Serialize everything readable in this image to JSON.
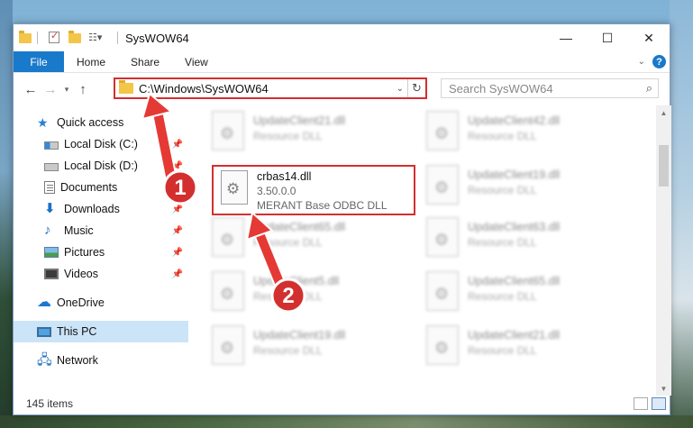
{
  "window": {
    "title": "SysWOW64",
    "controls": {
      "minimize": "—",
      "maximize": "☐",
      "close": "✕"
    }
  },
  "ribbon": {
    "tabs": [
      "File",
      "Home",
      "Share",
      "View"
    ],
    "help": "?"
  },
  "address": {
    "path": "C:\\Windows\\SysWOW64",
    "search_placeholder": "Search SysWOW64"
  },
  "nav": {
    "items": [
      {
        "label": "Quick access",
        "icon": "star-icon"
      },
      {
        "label": "Local Disk (C:)",
        "icon": "drive-icon",
        "pinned": true
      },
      {
        "label": "Local Disk (D:)",
        "icon": "drive-icon",
        "pinned": true
      },
      {
        "label": "Documents",
        "icon": "documents-icon",
        "pinned": true
      },
      {
        "label": "Downloads",
        "icon": "download-icon",
        "pinned": true
      },
      {
        "label": "Music",
        "icon": "music-icon",
        "pinned": true
      },
      {
        "label": "Pictures",
        "icon": "pictures-icon",
        "pinned": true
      },
      {
        "label": "Videos",
        "icon": "videos-icon",
        "pinned": true
      },
      {
        "label": "OneDrive",
        "icon": "cloud-icon"
      },
      {
        "label": "This PC",
        "icon": "computer-icon",
        "selected": true
      },
      {
        "label": "Network",
        "icon": "network-icon"
      }
    ]
  },
  "files": {
    "col1": [
      {
        "name": "UpdateClient21.dll",
        "type": "Resource DLL"
      },
      {
        "name": "UpdateClient65.dll",
        "type": "Resource DLL"
      },
      {
        "name": "UpdateClient5.dll",
        "type": "Resource DLL"
      },
      {
        "name": "UpdateClient19.dll",
        "type": "Resource DLL"
      }
    ],
    "col2": [
      {
        "name": "UpdateClient42.dll",
        "type": "Resource DLL"
      },
      {
        "name": "UpdateClient19.dll",
        "type": "Resource DLL"
      },
      {
        "name": "UpdateClient63.dll",
        "type": "Resource DLL"
      },
      {
        "name": "UpdateClient65.dll",
        "type": "Resource DLL"
      },
      {
        "name": "UpdateClient21.dll",
        "type": "Resource DLL"
      }
    ],
    "highlighted": {
      "name": "crbas14.dll",
      "version": "3.50.0.0",
      "description": "MERANT Base ODBC DLL"
    }
  },
  "status": {
    "item_count": "145 items"
  },
  "annotations": {
    "step1": "1",
    "step2": "2",
    "color": "#d32f2f"
  }
}
